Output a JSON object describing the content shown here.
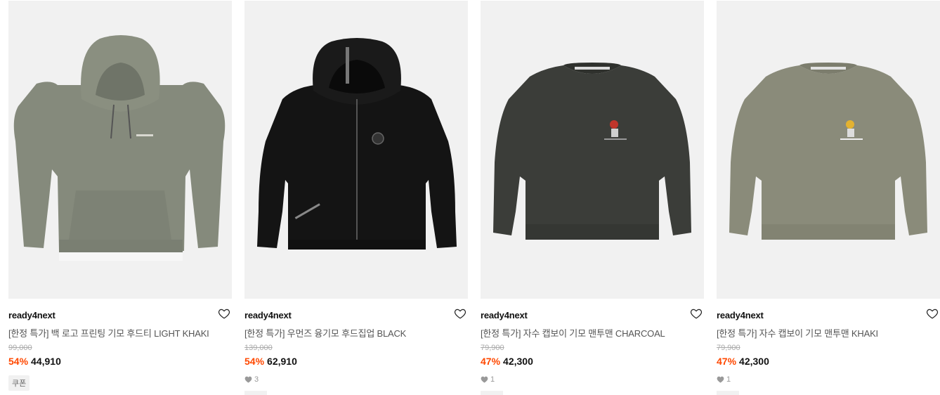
{
  "products": [
    {
      "brand": "ready4next",
      "title": "[한정 특가] 백 로고 프린팅 기모 후드티 LIGHT KHAKI",
      "original_price": "99,000",
      "discount": "54%",
      "price": "44,910",
      "badge": "쿠폰",
      "likes": "",
      "image": "khaki-hoodie",
      "garment_color": "#878c7e"
    },
    {
      "brand": "ready4next",
      "title": "[한정 특가] 우먼즈 융기모 후드집업 BLACK",
      "original_price": "139,000",
      "discount": "54%",
      "price": "62,910",
      "badge": "",
      "likes": "3",
      "image": "black-zip-hoodie",
      "garment_color": "#141414"
    },
    {
      "brand": "ready4next",
      "title": "[한정 특가] 자수 캡보이 기모 맨투맨 CHARCOAL",
      "original_price": "79,900",
      "discount": "47%",
      "price": "42,300",
      "badge": "",
      "likes": "1",
      "image": "charcoal-sweatshirt",
      "garment_color": "#3b3d39"
    },
    {
      "brand": "ready4next",
      "title": "[한정 특가] 자수 캡보이 기모 맨투맨 KHAKI",
      "original_price": "79,900",
      "discount": "47%",
      "price": "42,300",
      "badge": "",
      "likes": "1",
      "image": "khaki-sweatshirt",
      "garment_color": "#8a8b7a"
    }
  ],
  "colors": {
    "discount": "#ff4800",
    "image_bg": "#f1f1f1",
    "muted": "#aaaaaa"
  },
  "icons": [
    "heart-outline-icon",
    "heart-filled-icon"
  ]
}
